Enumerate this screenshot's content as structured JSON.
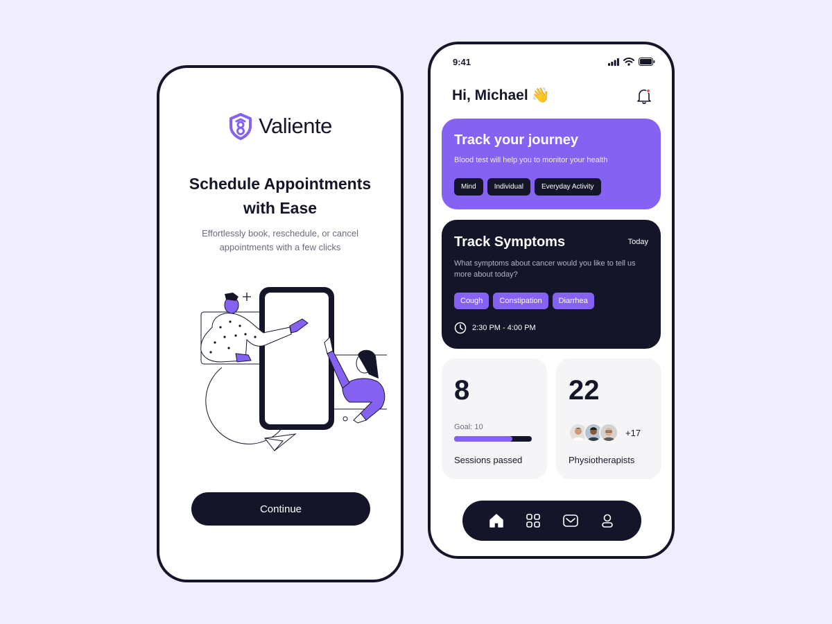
{
  "onboarding": {
    "logo_text": "Valiente",
    "title": "Schedule Appointments with Ease",
    "subtitle": "Effortlessly book, reschedule, or cancel appointments with a few clicks",
    "continue_label": "Continue"
  },
  "home": {
    "status_time": "9:41",
    "greeting": "Hi, Michael",
    "greeting_emoji": "👋",
    "journey_card": {
      "title": "Track your journey",
      "subtitle": "Blood test will help you to monitor your health",
      "chips": [
        "Mind",
        "Individual",
        "Everyday Activity"
      ]
    },
    "symptoms_card": {
      "title": "Track Symptoms",
      "date_label": "Today",
      "question": "What symptoms about cancer would you like to tell us more about today?",
      "chips": [
        "Cough",
        "Constipation",
        "Diarrhea"
      ],
      "time_range": "2:30 PM - 4:00 PM"
    },
    "sessions": {
      "value": "8",
      "goal_label": "Goal: 10",
      "progress": 0.75,
      "label": "Sessions passed"
    },
    "physio": {
      "value": "22",
      "more_count": "+17",
      "label": "Physiotherapists"
    },
    "nav": [
      {
        "icon": "home-icon",
        "active": true
      },
      {
        "icon": "grid-icon",
        "active": false
      },
      {
        "icon": "mail-icon",
        "active": false
      },
      {
        "icon": "profile-icon",
        "active": false
      }
    ]
  },
  "colors": {
    "background": "#F0EEFD",
    "accent": "#8562F2",
    "dark": "#15152A",
    "card_gray": "#F5F5F7"
  }
}
